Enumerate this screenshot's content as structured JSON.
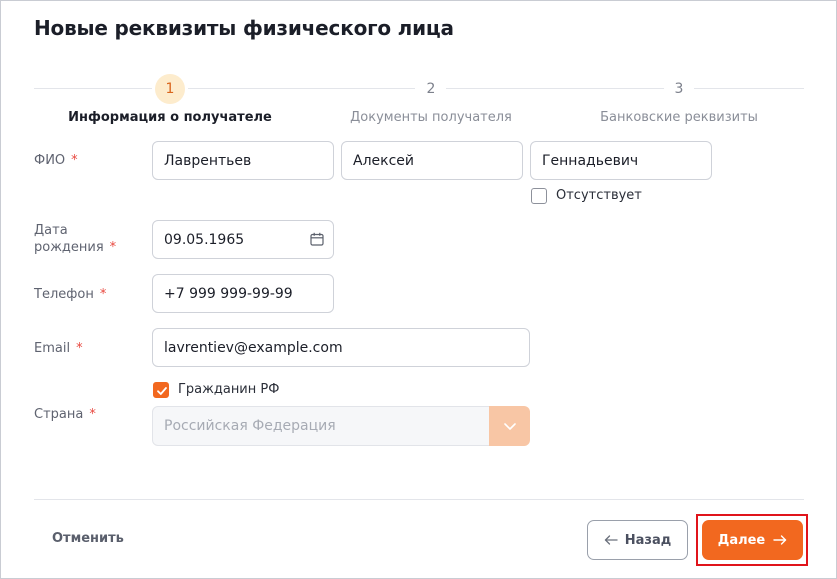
{
  "page": {
    "title": "Новые реквизиты физического лица"
  },
  "stepper": {
    "steps": [
      {
        "number": "1",
        "label": "Информация о получателе",
        "active": true
      },
      {
        "number": "2",
        "label": "Документы получателя",
        "active": false
      },
      {
        "number": "3",
        "label": "Банковские реквизиты",
        "active": false
      }
    ]
  },
  "form": {
    "fio": {
      "label": "ФИО",
      "required_mark": "*",
      "last_name": "Лаврентьев",
      "first_name": "Алексей",
      "patronymic": "Геннадьевич",
      "absent_label": "Отсутствует",
      "absent_checked": false
    },
    "birth_date": {
      "label_line1": "Дата",
      "label_line2": "рождения",
      "required_mark": "*",
      "value": "09.05.1965"
    },
    "phone": {
      "label": "Телефон",
      "required_mark": "*",
      "value": "+7 999 999-99-99"
    },
    "email": {
      "label": "Email",
      "required_mark": "*",
      "value": "lavrentiev@example.com"
    },
    "citizen": {
      "label": "Гражданин РФ",
      "checked": true
    },
    "country": {
      "label": "Страна",
      "required_mark": "*",
      "value": "Российская Федерация",
      "disabled": true
    }
  },
  "footer": {
    "cancel_label": "Отменить",
    "back_label": "Назад",
    "next_label": "Далее"
  },
  "colors": {
    "accent": "#f2681f",
    "highlight": "#e0141b",
    "required": "#e8483f"
  }
}
